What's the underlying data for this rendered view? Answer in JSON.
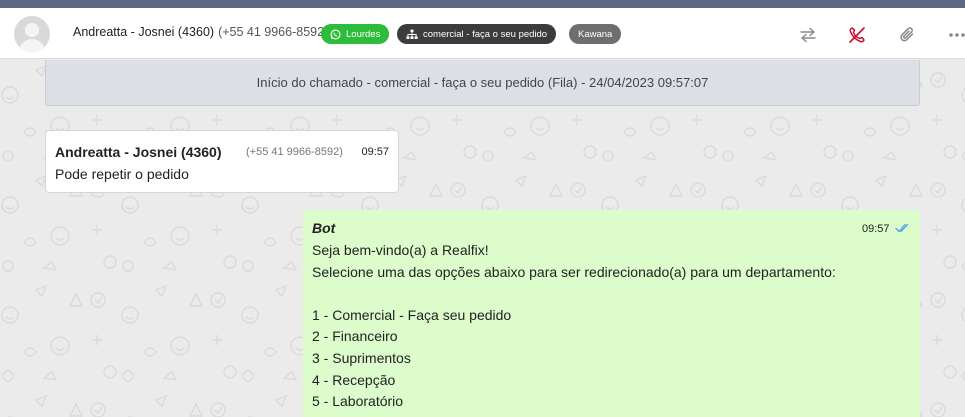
{
  "header": {
    "contact_name": "Andreatta - Josnei (4360)",
    "contact_phone": "(+55 41 9966-8592)",
    "tags": {
      "whatsapp": "Lourdes",
      "queue": "comercial - faça o seu pedido",
      "user": "Kawana"
    },
    "icons": [
      "transfer-icon",
      "hangup-icon",
      "paperclip-icon",
      "more-icon"
    ],
    "colors": {
      "whatsapp_tag": "#2ebd3a",
      "queue_tag": "#3c3c3c",
      "user_tag": "#6e6e6e",
      "hangup": "#c8102e"
    }
  },
  "chat": {
    "system_message": "Início do chamado - comercial - faça o seu pedido (Fila) - 24/04/2023 09:57:07",
    "incoming": {
      "sender": "Andreatta - Josnei (4360)",
      "phone": "(+55 41 9966-8592)",
      "time": "09:57",
      "text": "Pode repetir o pedido"
    },
    "outgoing": {
      "sender": "Bot",
      "time": "09:57",
      "status": "read",
      "lines": [
        "Seja bem-vindo(a) a Realfix!",
        "Selecione uma das opções abaixo para ser redirecionado(a) para um departamento:",
        "",
        "1 - Comercial - Faça seu pedido",
        "2 - Financeiro",
        "3 - Suprimentos",
        "4 - Recepção",
        "5 - Laboratório"
      ],
      "bubble_color": "#dcfccb"
    }
  }
}
